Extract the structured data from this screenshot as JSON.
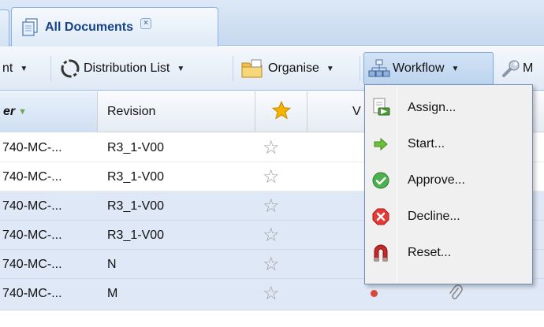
{
  "tab": {
    "title": "All Documents",
    "close_glyph": "×"
  },
  "toolbar": {
    "items": [
      {
        "label": "nt",
        "icon": ""
      },
      {
        "label": "Distribution List",
        "icon": "distribution-list-icon"
      },
      {
        "label": "Organise",
        "icon": "folder-icon"
      },
      {
        "label": "Workflow",
        "icon": "workflow-icon"
      },
      {
        "label": "M",
        "icon": "wrench-icon"
      }
    ],
    "arrow": "▼"
  },
  "grid": {
    "columns": [
      {
        "label": "er"
      },
      {
        "label": "Revision"
      },
      {
        "label": "",
        "icon": "star-icon"
      },
      {
        "label": "V"
      }
    ],
    "rows": [
      {
        "doc": "740-MC-...",
        "revision": "R3_1-V00",
        "selected": false
      },
      {
        "doc": "740-MC-...",
        "revision": "R3_1-V00",
        "selected": false
      },
      {
        "doc": "740-MC-...",
        "revision": "R3_1-V00",
        "selected": true
      },
      {
        "doc": "740-MC-...",
        "revision": "R3_1-V00",
        "selected": true
      },
      {
        "doc": "740-MC-...",
        "revision": "N",
        "selected": true
      },
      {
        "doc": "740-MC-...",
        "revision": "M",
        "selected": true
      }
    ],
    "star_glyph": "☆"
  },
  "menu": {
    "items": [
      {
        "label": "Assign...",
        "icon": "assign-icon"
      },
      {
        "label": "Start...",
        "icon": "green-arrow-icon"
      },
      {
        "label": "Approve...",
        "icon": "check-icon"
      },
      {
        "label": "Decline...",
        "icon": "x-icon"
      },
      {
        "label": "Reset...",
        "icon": "reset-magnet-icon"
      }
    ]
  },
  "colors": {
    "accent": "#15428b",
    "selected_row": "#dfe8f6",
    "menu_border": "#718bb7"
  }
}
